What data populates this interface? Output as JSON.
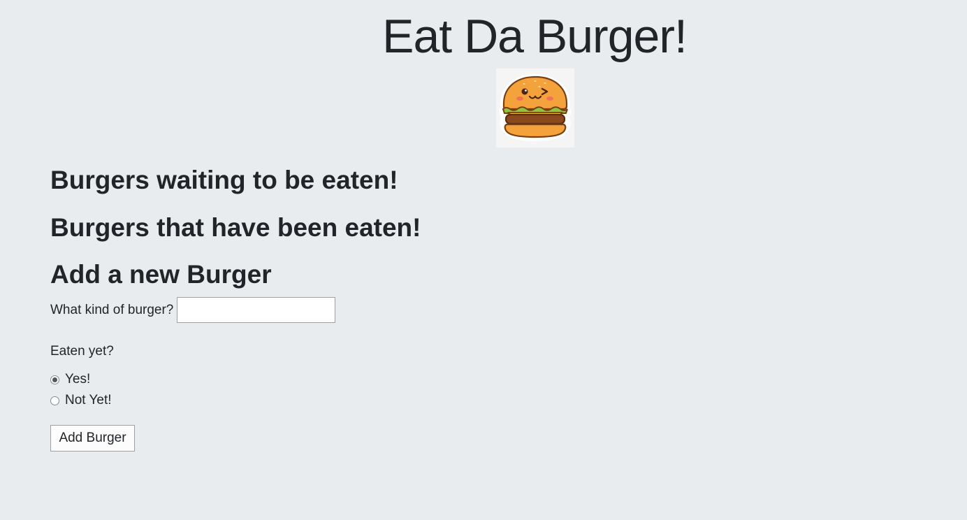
{
  "header": {
    "title": "Eat Da Burger!",
    "logo_icon": "winking-burger-icon"
  },
  "sections": {
    "waiting_heading": "Burgers waiting to be eaten!",
    "eaten_heading": "Burgers that have been eaten!",
    "add_heading": "Add a new Burger"
  },
  "form": {
    "burger_label": "What kind of burger?",
    "burger_value": "",
    "burger_placeholder": "",
    "eaten_label": "Eaten yet?",
    "options": [
      {
        "label": "Yes!",
        "checked": true
      },
      {
        "label": "Not Yet!",
        "checked": false
      }
    ],
    "submit_label": "Add Burger"
  },
  "colors": {
    "background": "#e9ecef",
    "text": "#212529"
  }
}
